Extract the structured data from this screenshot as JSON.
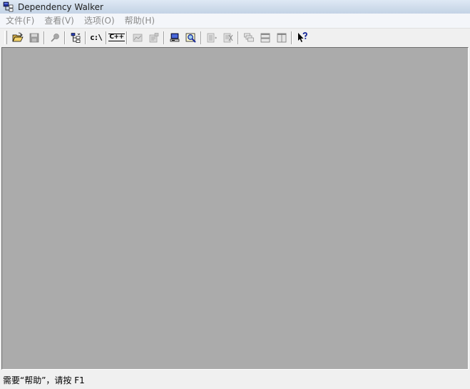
{
  "window": {
    "title": "Dependency Walker",
    "icon": "dependency-walker-app-icon"
  },
  "menu": {
    "items": [
      {
        "label": "文件(F)"
      },
      {
        "label": "查看(V)"
      },
      {
        "label": "选项(O)"
      },
      {
        "label": "帮助(H)"
      }
    ]
  },
  "toolbar": {
    "c_drive_label": "c:\\",
    "cpp_label": "C++"
  },
  "statusbar": {
    "text": "需要“帮助”，请按 F1"
  },
  "colors": {
    "client_background": "#ababab",
    "menu_disabled_text": "#8a8a8a",
    "titlebar": "#d3dfee"
  }
}
